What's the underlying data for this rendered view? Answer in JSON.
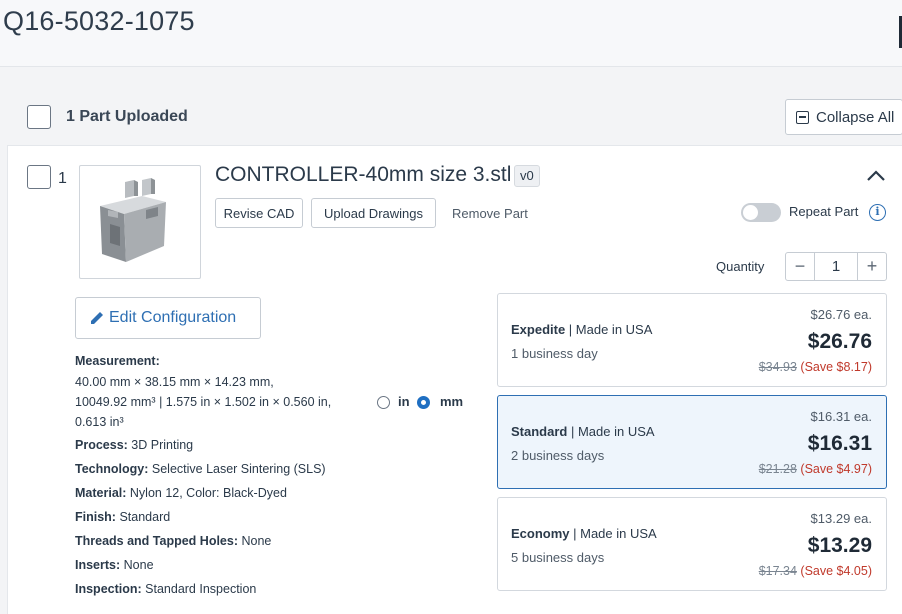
{
  "quote": {
    "id": "Q16-5032-1075"
  },
  "parts_header": {
    "uploaded_label": "1 Part Uploaded",
    "collapse_label": "Collapse All"
  },
  "part": {
    "number": "1",
    "name": "CONTROLLER-40mm size 3.stl",
    "version": "v0",
    "actions": {
      "revise": "Revise CAD",
      "upload": "Upload Drawings",
      "remove": "Remove Part"
    },
    "repeat_label": "Repeat Part",
    "quantity_label": "Quantity",
    "quantity": "1",
    "edit_config_label": "Edit Configuration",
    "measurement": {
      "label": "Measurement:",
      "line1": "40.00 mm × 38.15 mm × 14.23 mm,",
      "line2": "10049.92 mm³  |  1.575 in × 1.502 in × 0.560 in,",
      "line3": "0.613 in³",
      "unit_in": "in",
      "unit_mm": "mm",
      "selected_unit": "mm"
    },
    "specs": [
      {
        "label": "Process:",
        "value": "3D Printing"
      },
      {
        "label": "Technology:",
        "value": "Selective Laser Sintering (SLS)"
      },
      {
        "label": "Material:",
        "value": "Nylon 12, Color: Black-Dyed"
      },
      {
        "label": "Finish:",
        "value": "Standard"
      },
      {
        "label": "Threads and Tapped Holes:",
        "value": "None"
      },
      {
        "label": "Inserts:",
        "value": "None"
      },
      {
        "label": "Inspection:",
        "value": "Standard Inspection"
      }
    ]
  },
  "pricing": [
    {
      "tier": "Expedite",
      "origin": "Made in USA",
      "lead": "1 business day",
      "each": "$26.76 ea.",
      "total": "$26.76",
      "original": "$34.93",
      "save": "(Save $8.17)"
    },
    {
      "tier": "Standard",
      "origin": "Made in USA",
      "lead": "2 business days",
      "each": "$16.31 ea.",
      "total": "$16.31",
      "original": "$21.28",
      "save": "(Save $4.97)",
      "selected": true
    },
    {
      "tier": "Economy",
      "origin": "Made in USA",
      "lead": "5 business days",
      "each": "$13.29 ea.",
      "total": "$13.29",
      "original": "$17.34",
      "save": "(Save $4.05)"
    }
  ],
  "colors": {
    "accent": "#2e6fb3",
    "save": "#c0392b",
    "selected_bg": "#eef5fc"
  }
}
